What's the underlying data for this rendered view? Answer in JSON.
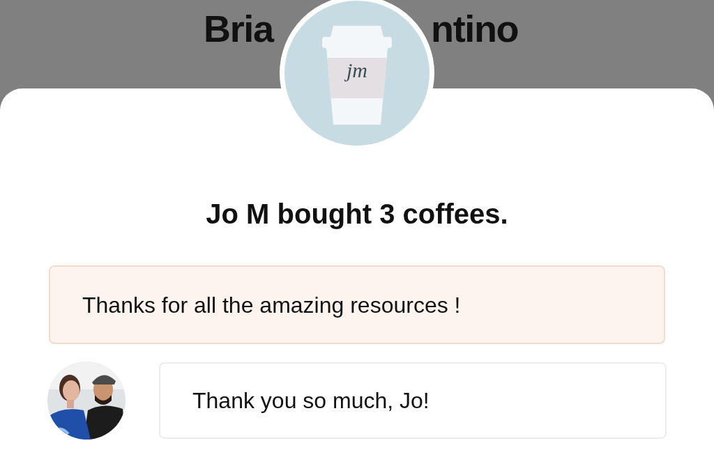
{
  "background_profile": {
    "name_parts": [
      "Bria",
      "ntino"
    ]
  },
  "supporter": {
    "avatar_text": "jm",
    "headline": "Jo M bought 3 coffees.",
    "message": "Thanks for all the amazing resources !"
  },
  "reply": {
    "text": "Thank you so much, Jo!"
  }
}
